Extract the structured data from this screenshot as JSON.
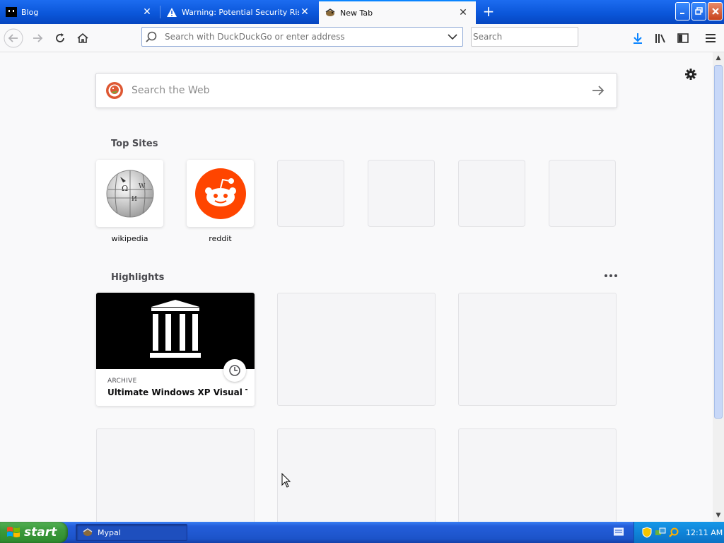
{
  "tabs": [
    {
      "label": "Blog",
      "active": false
    },
    {
      "label": "Warning: Potential Security Risk A",
      "active": false
    },
    {
      "label": "New Tab",
      "active": true
    }
  ],
  "navbar": {
    "url_placeholder": "Search with DuckDuckGo or enter address",
    "search_placeholder": "Search"
  },
  "newtab": {
    "web_search_placeholder": "Search the Web",
    "top_sites_title": "Top Sites",
    "top_sites": [
      {
        "label": "wikipedia",
        "icon": "wikipedia-globe-icon"
      },
      {
        "label": "reddit",
        "icon": "reddit-alien-icon"
      }
    ],
    "highlights_title": "Highlights",
    "highlights": [
      {
        "source": "ARCHIVE",
        "title": "Ultimate Windows XP Visual The...",
        "icon": "archive-building-icon"
      }
    ]
  },
  "taskbar": {
    "start_label": "start",
    "task_label": "Mypal",
    "clock": "12:11 AM"
  },
  "colors": {
    "accent": "#0a84ff",
    "reddit": "#ff4500",
    "xp_blue": "#245edb",
    "start_green": "#3c9a3c"
  }
}
